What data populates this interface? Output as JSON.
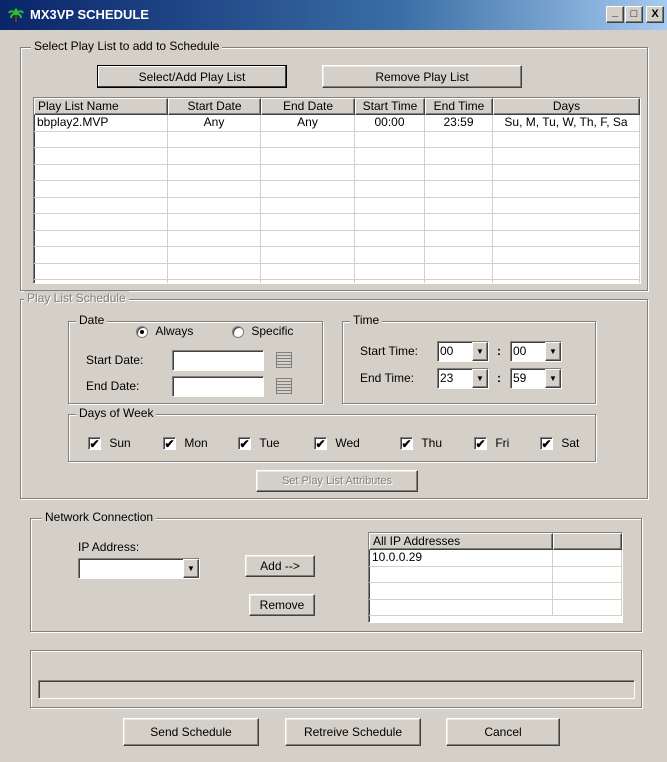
{
  "window": {
    "title": "MX3VP SCHEDULE",
    "minimize": "_",
    "maximize": "□",
    "close": "X"
  },
  "playlist_group": {
    "legend": "Select Play List to add to Schedule",
    "select_add_button": "Select/Add Play List",
    "remove_button": "Remove Play List",
    "columns": [
      "Play List Name",
      "Start Date",
      "End Date",
      "Start Time",
      "End Time",
      "Days"
    ],
    "rows": [
      [
        "bbplay2.MVP",
        "Any",
        "Any",
        "00:00",
        "23:59",
        "Su, M, Tu, W, Th, F, Sa"
      ]
    ]
  },
  "schedule_group": {
    "legend": "Play List Schedule",
    "date": {
      "legend": "Date",
      "always_label": "Always",
      "specific_label": "Specific",
      "selected": "always",
      "start_label": "Start Date:",
      "end_label": "End Date:",
      "start_value": "",
      "end_value": ""
    },
    "time": {
      "legend": "Time",
      "start_label": "Start Time:",
      "end_label": "End Time:",
      "start_hour": "00",
      "start_min": "00",
      "end_hour": "23",
      "end_min": "59",
      "separator": ":"
    },
    "days": {
      "legend": "Days of Week",
      "items": [
        {
          "label": "Sun",
          "checked": true
        },
        {
          "label": "Mon",
          "checked": true
        },
        {
          "label": "Tue",
          "checked": true
        },
        {
          "label": "Wed",
          "checked": true
        },
        {
          "label": "Thu",
          "checked": true
        },
        {
          "label": "Fri",
          "checked": true
        },
        {
          "label": "Sat",
          "checked": true
        }
      ]
    },
    "set_attributes_button": "Set Play List Attributes"
  },
  "network_group": {
    "legend": "Network Connection",
    "ip_label": "IP Address:",
    "ip_value": "",
    "add_button": "Add -->",
    "remove_button": "Remove",
    "list_header": "All IP Addresses",
    "addresses": [
      "10.0.0.29"
    ]
  },
  "progress": {
    "value": 0
  },
  "footer": {
    "send_button": "Send Schedule",
    "retrieve_button": "Retreive Schedule",
    "cancel_button": "Cancel"
  },
  "check_mark": "✔",
  "combo_arrow_glyph": "▼"
}
